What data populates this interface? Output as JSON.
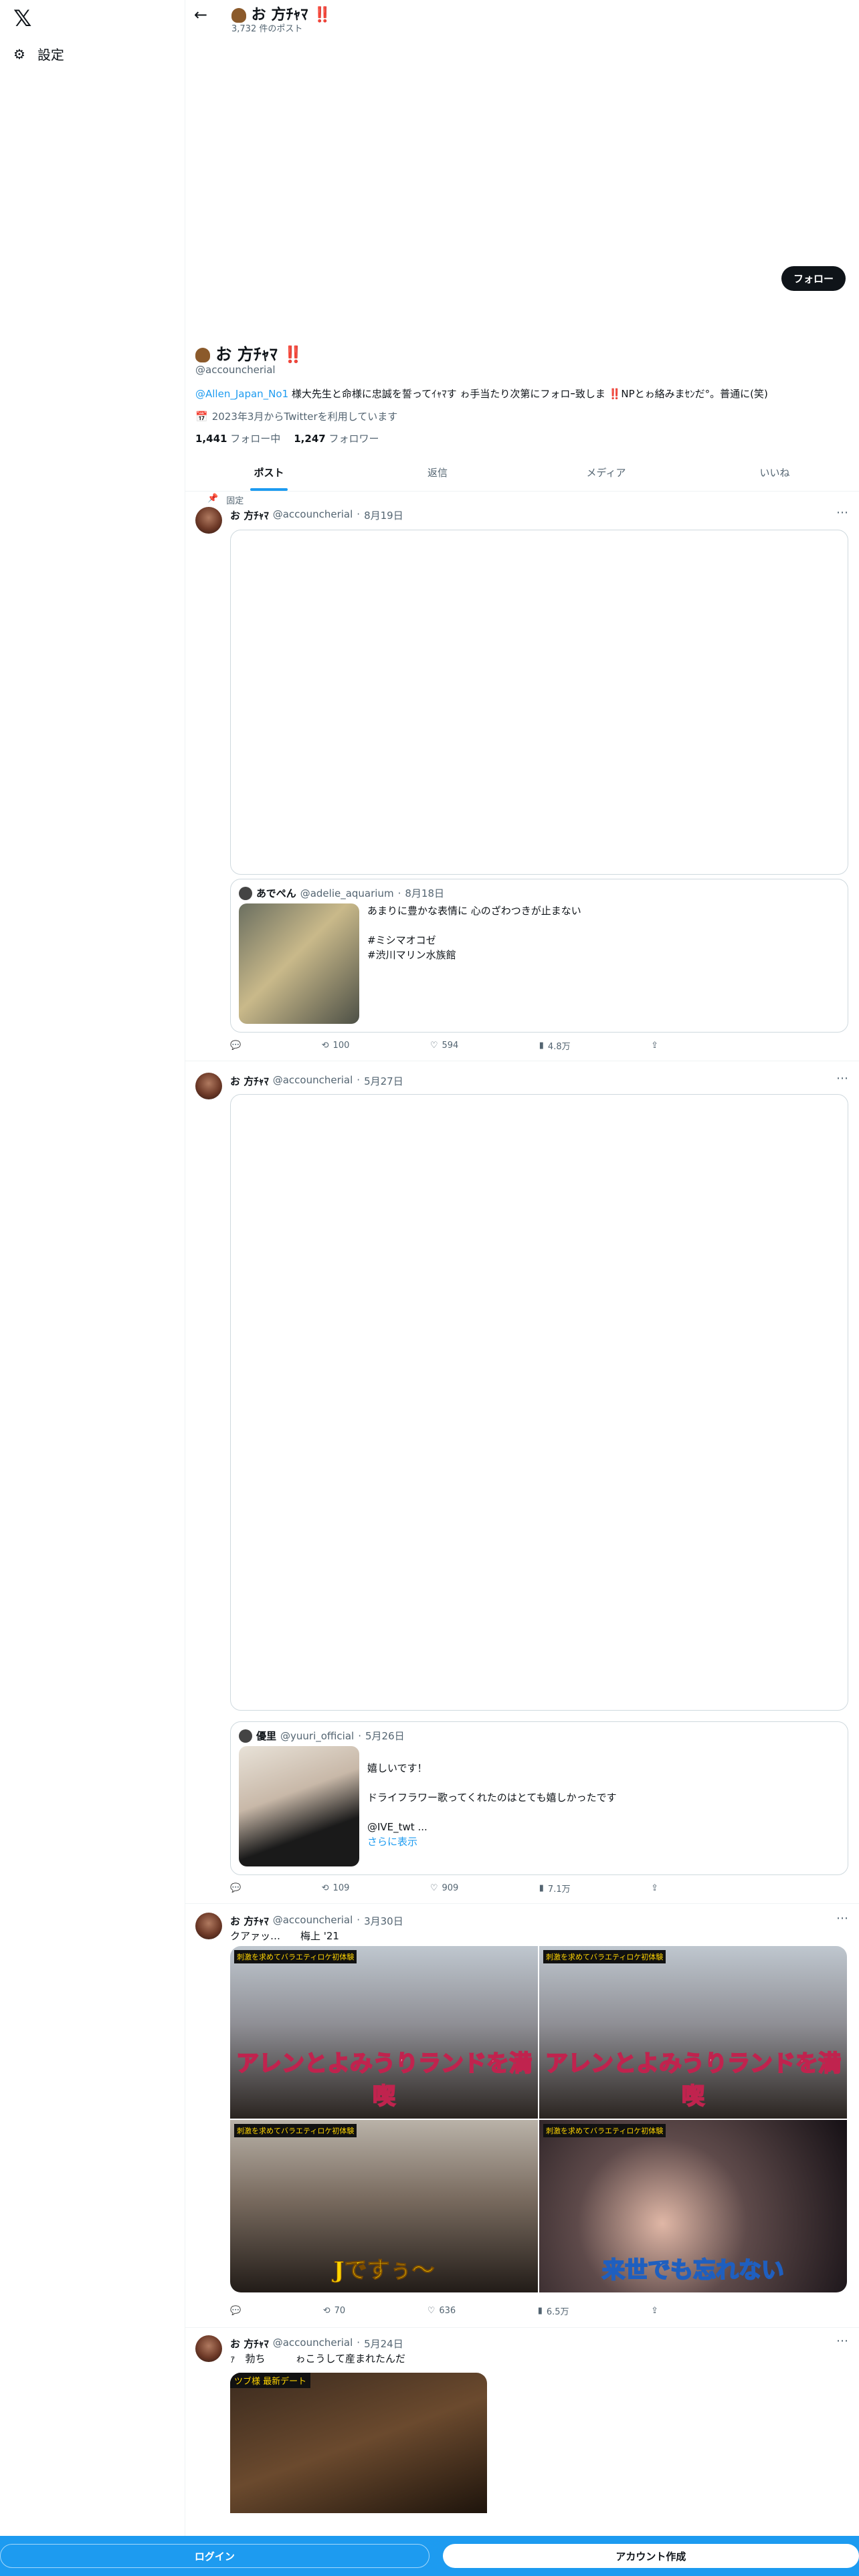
{
  "colors": {
    "accent": "#1d9bf0",
    "text": "#0f1419",
    "muted": "#536471"
  },
  "nav": {
    "logo": "𝕏",
    "settings_label": "設定"
  },
  "header": {
    "name": "お 方ﾁｬﾏ ‼️",
    "post_count": "3,732 件のポスト"
  },
  "profile": {
    "follow_label": "フォロー",
    "name": "お 方ﾁｬﾏ ‼️",
    "handle": "@accouncherial",
    "bio_link": "@Allen_Japan_No1",
    "bio_text": " 様大先生と命様に忠誠を誓ってｲｬﾏす ゎ手当たり次第にフォロｰ致しま ‼️NPとゎ絡みまｾﾝだ°。普通に(笑)",
    "joined": "2023年3月からTwitterを利用しています",
    "following_count": "1,441",
    "following_label": "フォロー中",
    "followers_count": "1,247",
    "followers_label": "フォロワー"
  },
  "tabs": [
    {
      "label": "ポスト"
    },
    {
      "label": "返信"
    },
    {
      "label": "メディア"
    },
    {
      "label": "いいね"
    }
  ],
  "pinned_label": "固定",
  "tweets": [
    {
      "name": "お 方ﾁｬﾏ",
      "handle": "@accouncherial",
      "date": "8月19日",
      "quote": {
        "name": "あでぺん",
        "handle": "@adelie_aquarium",
        "date": "8月18日",
        "text": "あまりに豊かな表情に 心のざわつきが止まない\n\n#ミシマオコゼ\n#渋川マリン水族館"
      },
      "stats": {
        "retweets": "100",
        "likes": "594",
        "views": "4.8万"
      }
    },
    {
      "name": "お 方ﾁｬﾏ",
      "handle": "@accouncherial",
      "date": "5月27日",
      "quote": {
        "name": "優里",
        "handle": "@yuuri_official",
        "date": "5月26日",
        "text": "嬉しいです！\n\nドライフラワー歌ってくれたのはとても嬉しかったです\n\n@IVE_twt ...",
        "more": "さらに表示"
      },
      "stats": {
        "retweets": "109",
        "likes": "909",
        "views": "7.1万"
      }
    },
    {
      "name": "お 方ﾁｬﾏ",
      "handle": "@accouncherial",
      "date": "3月30日",
      "text": "クアァッ…　　梅上 '21",
      "images": [
        {
          "banner": "刺激を求めてバラエティロケ初体験",
          "caption": "アレンとよみうりランドを満喫"
        },
        {
          "banner": "刺激を求めてバラエティロケ初体験",
          "caption": "アレンとよみうりランドを満喫"
        },
        {
          "banner": "刺激を求めてバラエティロケ初体験",
          "caption": "Jですぅ〜"
        },
        {
          "banner": "刺激を求めてバラエティロケ初体験",
          "caption": "来世でも忘れない"
        }
      ],
      "stats": {
        "retweets": "70",
        "likes": "636",
        "views": "6.5万"
      }
    },
    {
      "name": "お 方ﾁｬﾏ",
      "handle": "@accouncherial",
      "date": "5月24日",
      "text": "ｧ　勃ち　　　ゎこうして産まれたんだ",
      "video_banner": "ツブ様 最新デート"
    }
  ],
  "bottom": {
    "login": "ログイン",
    "signup": "アカウント作成"
  }
}
